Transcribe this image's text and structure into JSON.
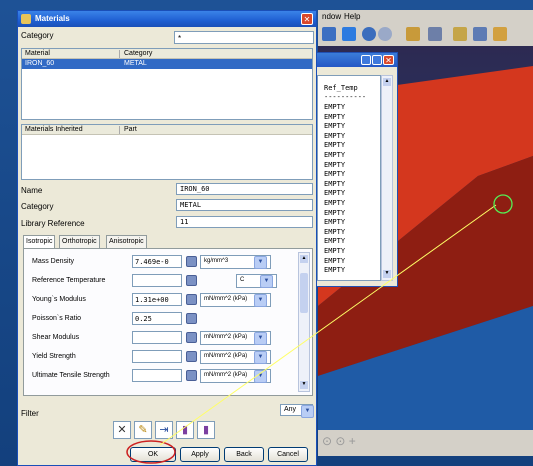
{
  "background_app": {
    "menu": [
      "ndow",
      "Help"
    ]
  },
  "log_window": {
    "header": "Ref_Temp",
    "divider": "----------",
    "lines": [
      "EMPTY",
      "EMPTY",
      "EMPTY",
      "EMPTY",
      "EMPTY",
      "EMPTY",
      "EMPTY",
      "EMPTY",
      "EMPTY",
      "EMPTY",
      "EMPTY",
      "EMPTY",
      "EMPTY",
      "EMPTY",
      "EMPTY",
      "EMPTY",
      "EMPTY",
      "EMPTY"
    ]
  },
  "dialog": {
    "title": "Materials",
    "category_label": "Category",
    "category_value": "*",
    "materials_table": {
      "columns": [
        "Material",
        "Category"
      ],
      "rows": [
        {
          "material": "IRON_60",
          "category": "METAL"
        }
      ]
    },
    "inherited_table": {
      "columns": [
        "Materials Inherited",
        "Part"
      ]
    },
    "name_label": "Name",
    "name_value": "IRON_60",
    "category2_label": "Category",
    "category2_value": "METAL",
    "library_label": "Library Reference",
    "library_value": "11",
    "tabs": [
      "Isotropic",
      "Orthotropic",
      "Anisotropic"
    ],
    "properties": [
      {
        "label": "Mass Density",
        "value": "7.469e-0",
        "unit": "kg/mm^3"
      },
      {
        "label": "Reference Temperature",
        "value": "",
        "unit": "C"
      },
      {
        "label": "Young`s Modulus",
        "value": "1.31e+00",
        "unit": "mN/mm^2 (kPa)"
      },
      {
        "label": "Poisson`s Ratio",
        "value": "0.25",
        "unit": ""
      },
      {
        "label": "Shear Modulus",
        "value": "",
        "unit": "mN/mm^2 (kPa)"
      },
      {
        "label": "Yield Strength",
        "value": "",
        "unit": "mN/mm^2 (kPa)"
      },
      {
        "label": "Ultimate Tensile Strength",
        "value": "",
        "unit": "mN/mm^2 (kPa)"
      }
    ],
    "filter_label": "Filter",
    "filter_value": "Any",
    "buttons": {
      "ok": "OK",
      "apply": "Apply",
      "back": "Back",
      "cancel": "Cancel"
    }
  },
  "viewport_bottom_icons": "⊙ ⊙ +",
  "colors": {
    "highlight": "#316ac5",
    "annotation": "#ffff66",
    "circle_red": "#cc2222",
    "circle_green": "#55ee55"
  }
}
